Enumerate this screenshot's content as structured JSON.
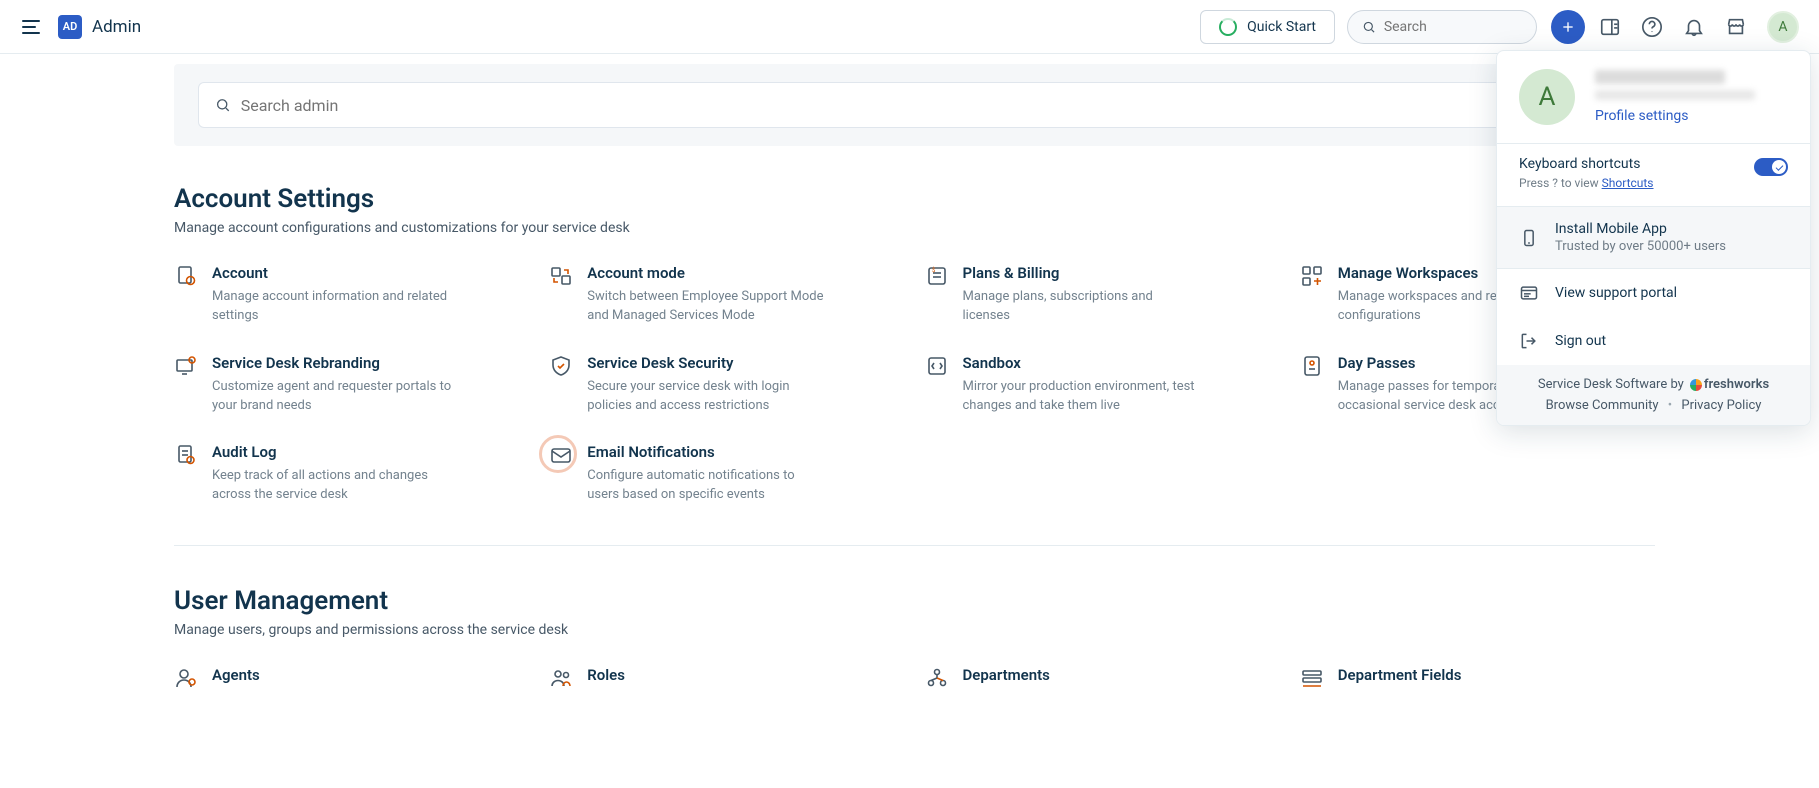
{
  "header": {
    "brand_badge": "AD",
    "brand_title": "Admin",
    "quick_start": "Quick Start",
    "search_placeholder": "Search",
    "avatar_initial": "A"
  },
  "admin_search": {
    "placeholder": "Search admin"
  },
  "sections": {
    "account": {
      "title": "Account Settings",
      "subtitle": "Manage account configurations and customizations for your service desk",
      "cards": [
        {
          "title": "Account",
          "desc": "Manage account information and related settings"
        },
        {
          "title": "Account mode",
          "desc": "Switch between Employee Support Mode and Managed Services Mode"
        },
        {
          "title": "Plans & Billing",
          "desc": "Manage plans, subscriptions and licenses"
        },
        {
          "title": "Manage Workspaces",
          "desc": "Manage workspaces and related configurations"
        },
        {
          "title": "Service Desk Rebranding",
          "desc": "Customize agent and requester portals to your brand needs"
        },
        {
          "title": "Service Desk Security",
          "desc": "Secure your service desk with login policies and access restrictions"
        },
        {
          "title": "Sandbox",
          "desc": "Mirror your production environment, test changes and take them live"
        },
        {
          "title": "Day Passes",
          "desc": "Manage passes for temporary and occasional service desk access"
        },
        {
          "title": "Audit Log",
          "desc": "Keep track of all actions and changes across the service desk"
        },
        {
          "title": "Email Notifications",
          "desc": "Configure automatic notifications to users based on specific events"
        }
      ]
    },
    "users": {
      "title": "User Management",
      "subtitle": "Manage users, groups and permissions across the service desk",
      "cards": [
        {
          "title": "Agents",
          "desc": ""
        },
        {
          "title": "Roles",
          "desc": ""
        },
        {
          "title": "Departments",
          "desc": ""
        },
        {
          "title": "Department Fields",
          "desc": ""
        }
      ]
    }
  },
  "dropdown": {
    "avatar_initial": "A",
    "profile_link": "Profile settings",
    "keyboard_title": "Keyboard shortcuts",
    "keyboard_sub_prefix": "Press ? to view ",
    "keyboard_sub_link": "Shortcuts",
    "mobile_title": "Install Mobile App",
    "mobile_sub": "Trusted by over 50000+ users",
    "support_portal": "View support portal",
    "sign_out": "Sign out",
    "footer_prefix": "Service Desk Software by",
    "footer_brand": "freshworks",
    "browse_community": "Browse Community",
    "privacy": "Privacy Policy"
  }
}
